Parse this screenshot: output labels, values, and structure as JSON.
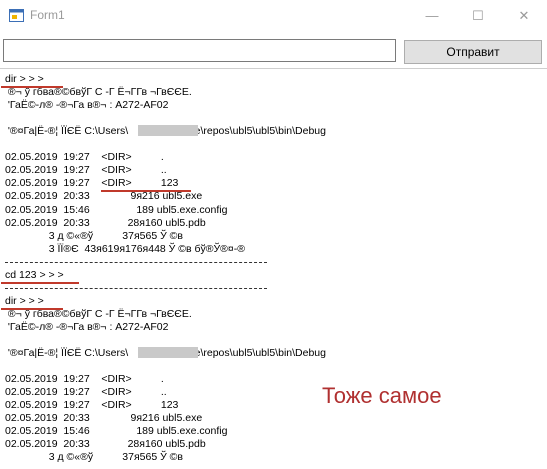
{
  "window": {
    "title": "Form1",
    "minimize_glyph": "—",
    "maximize_glyph": "☐",
    "close_glyph": "✕"
  },
  "command_input": {
    "value": ""
  },
  "send_button": {
    "label": "Отправит"
  },
  "console": {
    "lines": [
      "dir > > >",
      " ®¬ ў гбва®©бвўГ С -Г Ё¬ГГв ¬ГвЄЄЕ.",
      " 'ГаЁ©-л® -®¬Га в®¬ : A272-AF02",
      "",
      " '®¤Га|Ё-®¦ ЇЇЄЁ C:\\Users\\             \\source\\repos\\ubl5\\ubl5\\bin\\Debug",
      "",
      "02.05.2019  19:27    <DIR>          .",
      "02.05.2019  19:27    <DIR>          ..",
      "02.05.2019  19:27    <DIR>          123",
      "02.05.2019  20:33              9я216 ubl5.exe",
      "02.05.2019  15:46                189 ubl5.exe.config",
      "02.05.2019  20:33             28я160 ubl5.pdb",
      "               3 д ©«®ў          37я565 Ў ©в",
      "               3 ЇЇ®Є  43я619я176я448 Ў ©в бў®Ў®¤-®",
      "-",
      "cd 123 > > >",
      "-",
      "dir > > >",
      " ®¬ ў гбва®©бвўГ С -Г Ё¬ГГв ¬ГвЄЄЕ.",
      " 'ГаЁ©-л® -®¬Га в®¬ : A272-AF02",
      "",
      " '®¤Га|Ё-®¦ ЇЇЄЁ C:\\Users\\             \\source\\repos\\ubl5\\ubl5\\bin\\Debug",
      "",
      "02.05.2019  19:27    <DIR>          .",
      "02.05.2019  19:27    <DIR>          ..",
      "02.05.2019  19:27    <DIR>          123",
      "02.05.2019  20:33              9я216 ubl5.exe",
      "02.05.2019  15:46                189 ubl5.exe.config",
      "02.05.2019  20:33             28я160 ubl5.pdb",
      "               3 д ©«®ў          37я565 Ў ©в"
    ]
  },
  "annotation": {
    "text": "Тоже самое",
    "color": "#b03030"
  }
}
